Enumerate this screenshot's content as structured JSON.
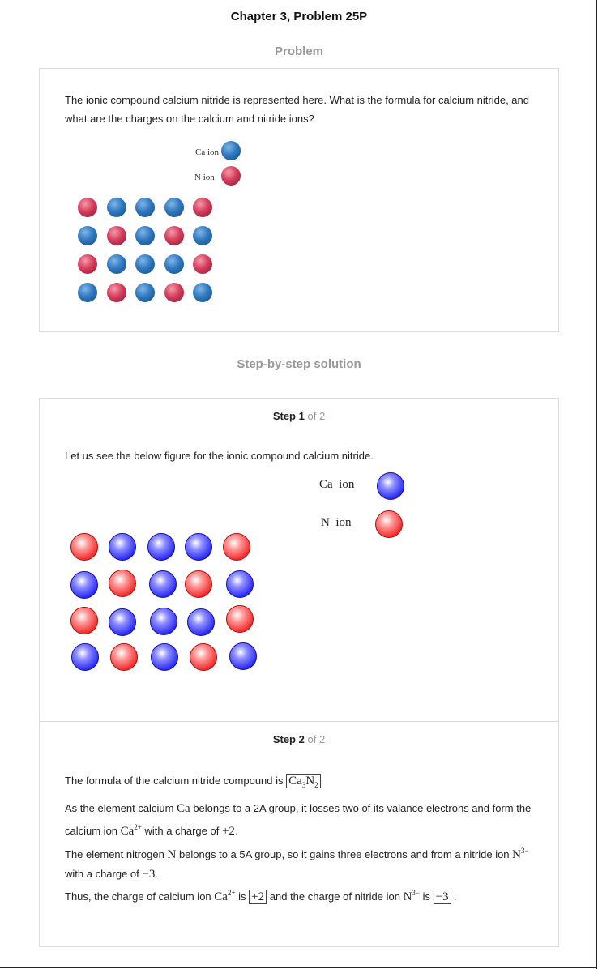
{
  "header": {
    "title": "Chapter 3, Problem 25P"
  },
  "problem": {
    "heading": "Problem",
    "text": "The ionic compound calcium nitride is represented here. What is the formula for calcium nitride, and what are the charges on the calcium and nitride ions?",
    "legend": {
      "ca_label": "Ca ion",
      "n_label": "N ion"
    },
    "grid": [
      [
        "n",
        "ca",
        "ca",
        "ca",
        "n"
      ],
      [
        "ca",
        "n",
        "ca",
        "n",
        "ca"
      ],
      [
        "n",
        "ca",
        "ca",
        "ca",
        "n"
      ],
      [
        "ca",
        "n",
        "ca",
        "n",
        "ca"
      ]
    ]
  },
  "solution": {
    "heading": "Step-by-step solution",
    "step_word": "Step",
    "of_word": "of 2",
    "step1": {
      "number": "1",
      "text": "Let us see the below figure for the ionic compound calcium nitride.",
      "legend": {
        "ca_label": "Ca  ion",
        "n_label": "N  ion"
      },
      "grid": [
        [
          "n",
          "ca",
          "ca",
          "ca",
          "n"
        ],
        [
          "ca",
          "n",
          "ca",
          "n",
          "ca"
        ],
        [
          "n",
          "ca",
          "ca",
          "ca",
          "n"
        ],
        [
          "ca",
          "n",
          "ca",
          "n",
          "ca"
        ]
      ]
    },
    "step2": {
      "number": "2",
      "p1_text": "The formula of the calcium nitride compound is",
      "formula": {
        "el1": "Ca",
        "sub1": "3",
        "el2": "N",
        "sub2": "2"
      },
      "p2_a": "As the element calcium",
      "p2_ca": "Ca",
      "p2_b": "belongs to a 2A group, it losses two of its valance electrons and form the calcium ion",
      "p2_ion": "Ca",
      "p2_ion_sup": "2+",
      "p2_c": "with a charge of",
      "p2_charge": "+2",
      "p3_a": "The element nitrogen",
      "p3_n": "N",
      "p3_b": "belongs to a 5A group, so it gains three electrons and from a nitride ion",
      "p3_ion": "N",
      "p3_ion_sup": "3−",
      "p3_c": "with a charge of",
      "p3_charge": "−3",
      "p4_a": "Thus, the charge of calcium ion",
      "p4_ca": "Ca",
      "p4_ca_sup": "2+",
      "p4_is": "is",
      "p4_ca_charge": "+2",
      "p4_b": "and the charge of nitride ion",
      "p4_n": "N",
      "p4_n_sup": "3−",
      "p4_is2": "is",
      "p4_n_charge": "−3"
    }
  }
}
